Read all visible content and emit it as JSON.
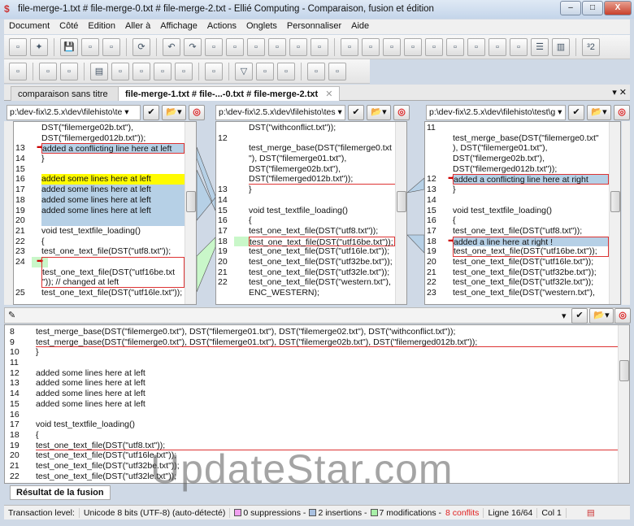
{
  "window": {
    "title": "file-merge-1.txt # file-merge-0.txt # file-merge-2.txt - Ellié Computing - Comparaison, fusion et édition",
    "minimize": "–",
    "maximize": "□",
    "close": "X"
  },
  "menu": [
    "Document",
    "Côté",
    "Edition",
    "Aller à",
    "Affichage",
    "Actions",
    "Onglets",
    "Personnaliser",
    "Aide"
  ],
  "toolbar1": [
    "new-compare-icon",
    "wizard-icon",
    "|",
    "save-icon",
    "save-all-icon",
    "copy-icon",
    "|",
    "refresh-icon",
    "|",
    "undo-icon",
    "redo-icon",
    "first-diff-icon",
    "next-diff-icon",
    "prev-change-icon",
    "next-change-icon",
    "prev-conflict-icon",
    "next-conflict-icon",
    "|",
    "accept-left-icon",
    "accept-base-icon",
    "accept-right-icon",
    "accept-left-right-icon",
    "accept-right-left-icon",
    "accept-edit-icon",
    "merge-all-icon",
    "merge-nonconflict-icon",
    "reject-icon",
    "layout-horizontal-icon",
    "layout-vertical-icon",
    "|",
    "three-two-icon"
  ],
  "toolbar2": [
    "open-folder-icon",
    "|",
    "doc-left-icon",
    "doc-right-icon",
    "|",
    "list-icon",
    "image-icon",
    "doc-compare-icon",
    "doc-green-icon",
    "doc-edit-icon",
    "|",
    "doc-options-icon",
    "|",
    "filter-icon",
    "filter-clear-icon",
    "folder-settings-icon",
    "|",
    "doc-prev-icon",
    "doc-next-icon"
  ],
  "tabs": [
    {
      "label": "comparaison sans titre"
    },
    {
      "label": "file-merge-1.txt # file-...-0.txt # file-merge-2.txt"
    }
  ],
  "paths": [
    "p:\\dev-fix\\2.5.x\\dev\\filehisto\\te",
    "p:\\dev-fix\\2.5.x\\dev\\filehisto\\tes",
    "p:\\dev-fix\\2.5.x\\dev\\filehisto\\test\\g"
  ],
  "panes": {
    "left": [
      {
        "n": "",
        "t": "DST(\"filemerge02b.txt\"),",
        "c": "i2"
      },
      {
        "n": "",
        "t": "DST(\"filemerged012b.txt\"));",
        "c": "i2"
      },
      {
        "n": "13",
        "t": "added a conflicting line here at left",
        "c": "i1 blue box",
        "m": true
      },
      {
        "n": "14",
        "t": "}",
        "c": ""
      },
      {
        "n": "15",
        "t": "",
        "c": ""
      },
      {
        "n": "16",
        "t": "added some lines here at left",
        "c": "yellow"
      },
      {
        "n": "17",
        "t": "added some lines here at left",
        "c": "blue"
      },
      {
        "n": "18",
        "t": "added some lines here at left",
        "c": "blue"
      },
      {
        "n": "19",
        "t": "added some lines here at left",
        "c": "blue"
      },
      {
        "n": "20",
        "t": "",
        "c": "blue"
      },
      {
        "n": "21",
        "t": "void test_textfile_loading()",
        "c": ""
      },
      {
        "n": "22",
        "t": "{",
        "c": ""
      },
      {
        "n": "23",
        "t": "test_one_text_file(DST(\"utf8.txt\"));",
        "c": "i1"
      },
      {
        "n": "24",
        "t": "",
        "c": "boxt green",
        "m": true
      },
      {
        "n": "",
        "t": "test_one_text_file(DST(\"utf16be.txt",
        "c": "i2 boxm"
      },
      {
        "n": "",
        "t": "\")); // changed at left",
        "c": "i2 boxb"
      },
      {
        "n": "25",
        "t": "test_one_text_file(DST(\"utf16le.txt\"));",
        "c": "i1"
      }
    ],
    "center": [
      {
        "n": "",
        "t": "DST(\"withconflict.txt\"));",
        "c": "i2"
      },
      {
        "n": "12",
        "t": "",
        "c": ""
      },
      {
        "n": "",
        "t": "test_merge_base(DST(\"filemerge0.txt",
        "c": "i2"
      },
      {
        "n": "",
        "t": "\"), DST(\"filemerge01.txt\"),",
        "c": "i2"
      },
      {
        "n": "",
        "t": "DST(\"filemerge02b.txt\"),",
        "c": "i2"
      },
      {
        "n": "",
        "t": "DST(\"filemerged012b.txt\"));",
        "c": "i2 ul"
      },
      {
        "n": "13",
        "t": "}",
        "c": ""
      },
      {
        "n": "14",
        "t": "",
        "c": ""
      },
      {
        "n": "15",
        "t": "void test_textfile_loading()",
        "c": ""
      },
      {
        "n": "16",
        "t": "{",
        "c": ""
      },
      {
        "n": "17",
        "t": "test_one_text_file(DST(\"utf8.txt\"));",
        "c": "i1"
      },
      {
        "n": "18",
        "t": "test_one_text_file(DST(\"utf16be.txt\"));",
        "c": "i1 box green"
      },
      {
        "n": "19",
        "t": "test_one_text_file(DST(\"utf16le.txt\"));",
        "c": "i1"
      },
      {
        "n": "20",
        "t": "test_one_text_file(DST(\"utf32be.txt\"));",
        "c": "i1"
      },
      {
        "n": "21",
        "t": "test_one_text_file(DST(\"utf32le.txt\"));",
        "c": "i1"
      },
      {
        "n": "22",
        "t": "test_one_text_file(DST(\"western.txt\"),",
        "c": "i1"
      },
      {
        "n": "",
        "t": "ENC_WESTERN);",
        "c": "i2"
      }
    ],
    "right": [
      {
        "n": "11",
        "t": "",
        "c": ""
      },
      {
        "n": "",
        "t": "test_merge_base(DST(\"filemerge0.txt\"",
        "c": "i2"
      },
      {
        "n": "",
        "t": "), DST(\"filemerge01.txt\"),",
        "c": "i2"
      },
      {
        "n": "",
        "t": "DST(\"filemerge02b.txt\"),",
        "c": "i2"
      },
      {
        "n": "",
        "t": "DST(\"filemerged012b.txt\"));",
        "c": "i2"
      },
      {
        "n": "12",
        "t": "added a conflicting line here at right",
        "c": "i1 blue box",
        "m": true
      },
      {
        "n": "13",
        "t": "}",
        "c": ""
      },
      {
        "n": "14",
        "t": "",
        "c": ""
      },
      {
        "n": "15",
        "t": "void test_textfile_loading()",
        "c": ""
      },
      {
        "n": "16",
        "t": "{",
        "c": ""
      },
      {
        "n": "17",
        "t": "test_one_text_file(DST(\"utf8.txt\"));",
        "c": "i1"
      },
      {
        "n": "18",
        "t": "added a line here at right !",
        "c": "i1 blue boxt",
        "m": true
      },
      {
        "n": "19",
        "t": "test_one_text_file(DST(\"utf16be.txt\"));",
        "c": "i1 boxb"
      },
      {
        "n": "20",
        "t": "test_one_text_file(DST(\"utf16le.txt\"));",
        "c": "i1"
      },
      {
        "n": "21",
        "t": "test_one_text_file(DST(\"utf32be.txt\"));",
        "c": "i1"
      },
      {
        "n": "22",
        "t": "test_one_text_file(DST(\"utf32le.txt\"));",
        "c": "i1"
      },
      {
        "n": "23",
        "t": "test_one_text_file(DST(\"western.txt\"),",
        "c": "i1"
      }
    ],
    "merged": [
      {
        "n": "8",
        "t": "test_merge_base(DST(\"filemerge0.txt\"), DST(\"filemerge01.txt\"), DST(\"filemerge02.txt\"), DST(\"withconflict.txt\"));",
        "c": "i1"
      },
      {
        "n": "9",
        "t": "test_merge_base(DST(\"filemerge0.txt\"), DST(\"filemerge01.txt\"), DST(\"filemerge02b.txt\"), DST(\"filemerged012b.txt\"));",
        "c": "i1 ul"
      },
      {
        "n": "10",
        "t": "}",
        "c": ""
      },
      {
        "n": "11",
        "t": "",
        "c": ""
      },
      {
        "n": "12",
        "t": "added some lines here at left",
        "c": ""
      },
      {
        "n": "13",
        "t": "added some lines here at left",
        "c": ""
      },
      {
        "n": "14",
        "t": "added some lines here at left",
        "c": ""
      },
      {
        "n": "15",
        "t": "added some lines here at left",
        "c": ""
      },
      {
        "n": "16",
        "t": "",
        "c": ""
      },
      {
        "n": "17",
        "t": "void test_textfile_loading()",
        "c": ""
      },
      {
        "n": "18",
        "t": "{",
        "c": ""
      },
      {
        "n": "19",
        "t": "test_one_text_file(DST(\"utf8.txt\"));",
        "c": "i1 ul"
      },
      {
        "n": "20",
        "t": "test_one_text_file(DST(\"utf16le.txt\"));",
        "c": "i1"
      },
      {
        "n": "21",
        "t": "test_one_text_file(DST(\"utf32be.txt\"));",
        "c": "i1"
      },
      {
        "n": "22",
        "t": "test_one_text_file(DST(\"utf32le.txt\"));",
        "c": "i1"
      }
    ]
  },
  "result_tab": "Résultat de la fusion",
  "status": {
    "transaction": "Transaction level:",
    "encoding": "Unicode 8 bits (UTF-8) (auto-détecté)",
    "suppressions": "0 suppressions -",
    "insertions": "2 insertions -",
    "modifications": "7 modifications -",
    "conflicts": "8 conflits",
    "line": "Ligne 16/64",
    "col": "Col 1"
  },
  "colors": {
    "suppression": "#f0a0f0",
    "insertion": "#a8c0e0",
    "modification": "#a8f0a8",
    "conflict": "#e02020"
  },
  "watermark": "UpdateStar.com"
}
